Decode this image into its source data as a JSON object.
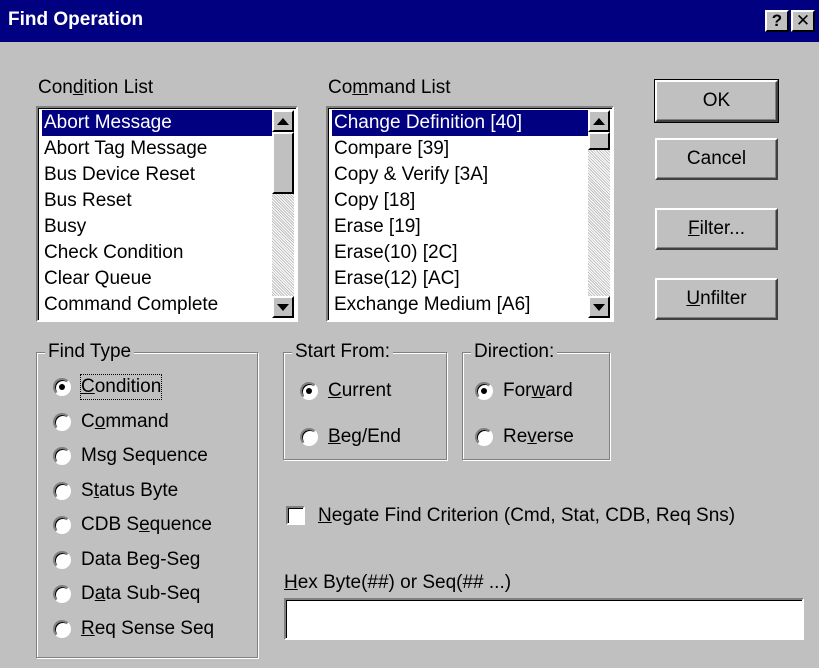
{
  "window": {
    "title": "Find Operation",
    "help_button": "?",
    "close_button": "✕"
  },
  "condition_list": {
    "label_pre": "Con",
    "label_mn": "d",
    "label_post": "ition List",
    "items": [
      "Abort Message",
      "Abort Tag Message",
      "Bus Device Reset",
      "Bus Reset",
      "Busy",
      "Check Condition",
      "Clear Queue",
      "Command Complete"
    ],
    "selected_index": 0
  },
  "command_list": {
    "label_pre": "Co",
    "label_mn": "m",
    "label_post": "mand List",
    "items": [
      "Change Definition [40]",
      "Compare [39]",
      "Copy & Verify [3A]",
      "Copy [18]",
      "Erase [19]",
      "Erase(10) [2C]",
      "Erase(12) [AC]",
      "Exchange Medium [A6]"
    ],
    "selected_index": 0
  },
  "buttons": {
    "ok": "OK",
    "cancel": "Cancel",
    "filter_mn": "F",
    "filter_rest": "ilter...",
    "unfilter_mn": "U",
    "unfilter_rest": "nfilter"
  },
  "find_type": {
    "title": "Find Type",
    "options": [
      {
        "pre": "",
        "mn": "C",
        "post": "ondition",
        "checked": true
      },
      {
        "pre": "C",
        "mn": "o",
        "post": "mmand",
        "checked": false
      },
      {
        "pre": "Ms",
        "mn": "g",
        "post": " Sequence",
        "checked": false
      },
      {
        "pre": "S",
        "mn": "t",
        "post": "atus Byte",
        "checked": false
      },
      {
        "pre": "CDB S",
        "mn": "e",
        "post": "quence",
        "checked": false
      },
      {
        "pre": "Data Beg-Seg",
        "mn": "",
        "post": "",
        "checked": false
      },
      {
        "pre": "D",
        "mn": "a",
        "post": "ta Sub-Seq",
        "checked": false
      },
      {
        "pre": "",
        "mn": "R",
        "post": "eq Sense Seq",
        "checked": false
      }
    ]
  },
  "start_from": {
    "title": "Start From:",
    "options": [
      {
        "pre": "",
        "mn": "C",
        "post": "urrent",
        "checked": true
      },
      {
        "pre": "",
        "mn": "B",
        "post": "eg/End",
        "checked": false
      }
    ]
  },
  "direction": {
    "title": "Direction:",
    "options": [
      {
        "pre": "For",
        "mn": "w",
        "post": "ard",
        "checked": true
      },
      {
        "pre": "Re",
        "mn": "v",
        "post": "erse",
        "checked": false
      }
    ]
  },
  "negate": {
    "mn": "N",
    "rest": "egate Find Criterion (Cmd, Stat, CDB, Req Sns)",
    "checked": false
  },
  "hex_field": {
    "label_mn": "H",
    "label_rest": "ex Byte(##) or Seq(## ...)",
    "value": ""
  }
}
